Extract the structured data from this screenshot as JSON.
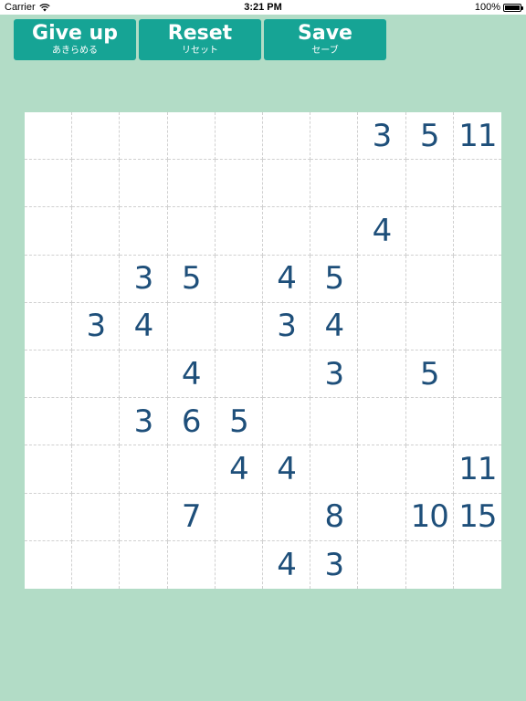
{
  "status_bar": {
    "carrier": "Carrier",
    "time": "3:21 PM",
    "battery": "100%"
  },
  "toolbar": {
    "give_up": {
      "label": "Give up",
      "sublabel": "あきらめる"
    },
    "reset": {
      "label": "Reset",
      "sublabel": "リセット"
    },
    "save": {
      "label": "Save",
      "sublabel": "セーブ"
    }
  },
  "board": {
    "rows": [
      [
        "",
        "",
        "",
        "",
        "",
        "",
        "",
        "3",
        "5",
        "11"
      ],
      [
        "",
        "",
        "",
        "",
        "",
        "",
        "",
        "",
        "",
        ""
      ],
      [
        "",
        "",
        "",
        "",
        "",
        "",
        "",
        "4",
        "",
        ""
      ],
      [
        "",
        "",
        "3",
        "5",
        "",
        "4",
        "5",
        "",
        "",
        ""
      ],
      [
        "",
        "3",
        "4",
        "",
        "",
        "3",
        "4",
        "",
        "",
        ""
      ],
      [
        "",
        "",
        "",
        "4",
        "",
        "",
        "3",
        "",
        "5",
        ""
      ],
      [
        "",
        "",
        "3",
        "6",
        "5",
        "",
        "",
        "",
        "",
        ""
      ],
      [
        "",
        "",
        "",
        "",
        "4",
        "4",
        "",
        "",
        "",
        "11"
      ],
      [
        "",
        "",
        "",
        "7",
        "",
        "",
        "8",
        "",
        "10",
        "15"
      ],
      [
        "",
        "",
        "",
        "",
        "",
        "4",
        "3",
        "",
        "",
        ""
      ]
    ]
  },
  "colors": {
    "background": "#b2dcc6",
    "button": "#16a495",
    "number": "#1e4f7a"
  }
}
